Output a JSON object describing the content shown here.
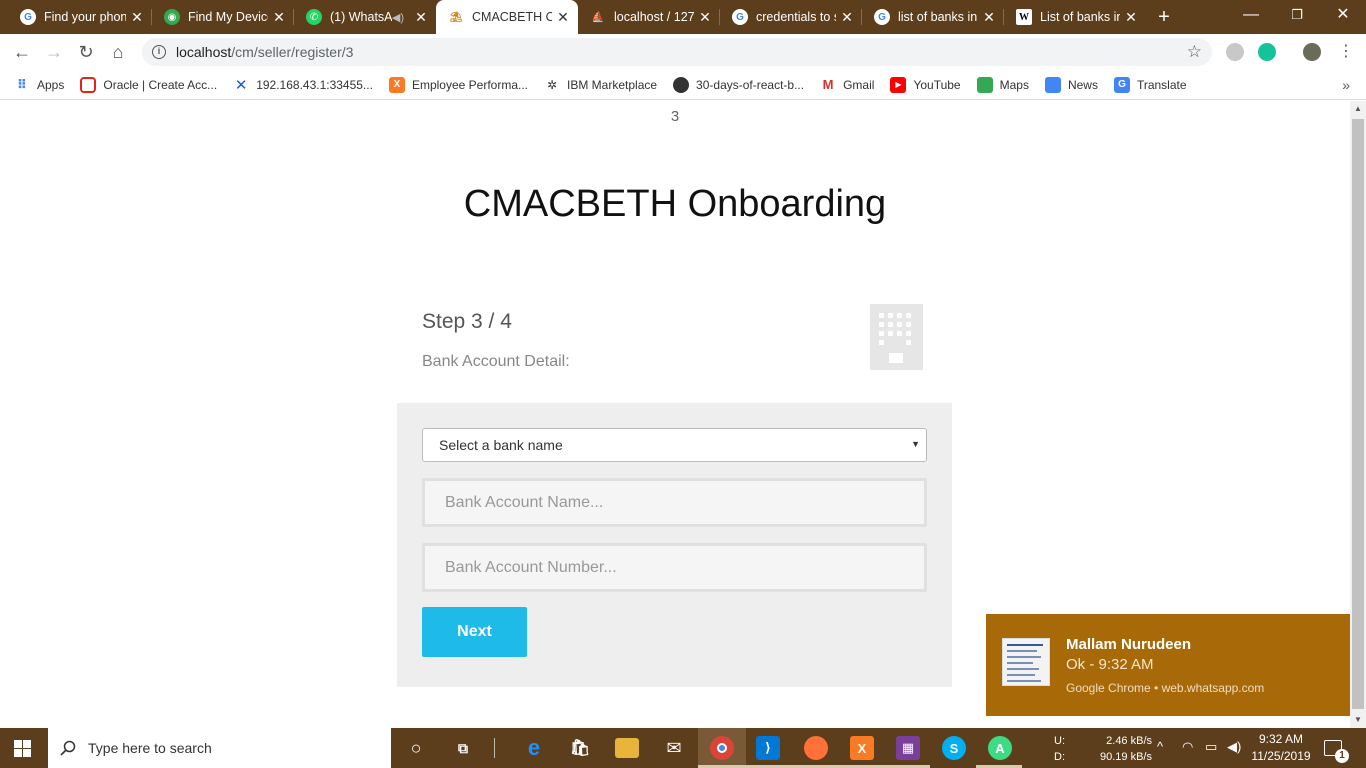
{
  "browser": {
    "tabs": [
      {
        "label": "Find your phon",
        "icon": "google-icon"
      },
      {
        "label": "Find My Device",
        "icon": "find-device-icon"
      },
      {
        "label": "(1) WhatsA",
        "icon": "whatsapp-icon"
      },
      {
        "label": "CMACBETH On",
        "icon": "cmacbeth-icon"
      },
      {
        "label": "localhost / 127",
        "icon": "phpmyadmin-icon"
      },
      {
        "label": "credentials to s",
        "icon": "google-icon"
      },
      {
        "label": "list of banks in",
        "icon": "google-icon"
      },
      {
        "label": "List of banks in",
        "icon": "wikipedia-icon"
      }
    ],
    "url_host": "localhost",
    "url_path": "/cm/seller/register/3",
    "bookmarks": [
      {
        "label": "Apps",
        "icon": "apps-grid-icon"
      },
      {
        "label": "Oracle | Create Acc...",
        "icon": "oracle-icon"
      },
      {
        "label": "192.168.43.1:33455...",
        "icon": "xender-icon"
      },
      {
        "label": "Employee Performa...",
        "icon": "xampp-icon"
      },
      {
        "label": "IBM Marketplace",
        "icon": "ibm-icon"
      },
      {
        "label": "30-days-of-react-b...",
        "icon": "github-icon"
      },
      {
        "label": "Gmail",
        "icon": "gmail-icon"
      },
      {
        "label": "YouTube",
        "icon": "youtube-icon"
      },
      {
        "label": "Maps",
        "icon": "maps-icon"
      },
      {
        "label": "News",
        "icon": "news-icon"
      },
      {
        "label": "Translate",
        "icon": "translate-icon"
      }
    ]
  },
  "page": {
    "step_number": "3",
    "title": "CMACBETH Onboarding",
    "step_label": "Step 3 / 4",
    "subtitle": "Bank Account Detail:",
    "form": {
      "bank_select_value": "Select a bank name",
      "account_name_placeholder": "Bank Account Name...",
      "account_number_placeholder": "Bank Account Number...",
      "next_label": "Next"
    }
  },
  "notification": {
    "sender": "Mallam Nurudeen",
    "message": "Ok - 9:32 AM",
    "source": "Google Chrome • web.whatsapp.com"
  },
  "taskbar": {
    "search_placeholder": "Type here to search",
    "net_up_label": "U:",
    "net_down_label": "D:",
    "net_up_value": "2.46 kB/s",
    "net_down_value": "90.19 kB/s",
    "time": "9:32 AM",
    "date": "11/25/2019",
    "notification_count": "1"
  },
  "colors": {
    "accent": "#1ebbe8",
    "chrome_frame": "#5c3d1c",
    "toast_bg": "#a86a08"
  }
}
